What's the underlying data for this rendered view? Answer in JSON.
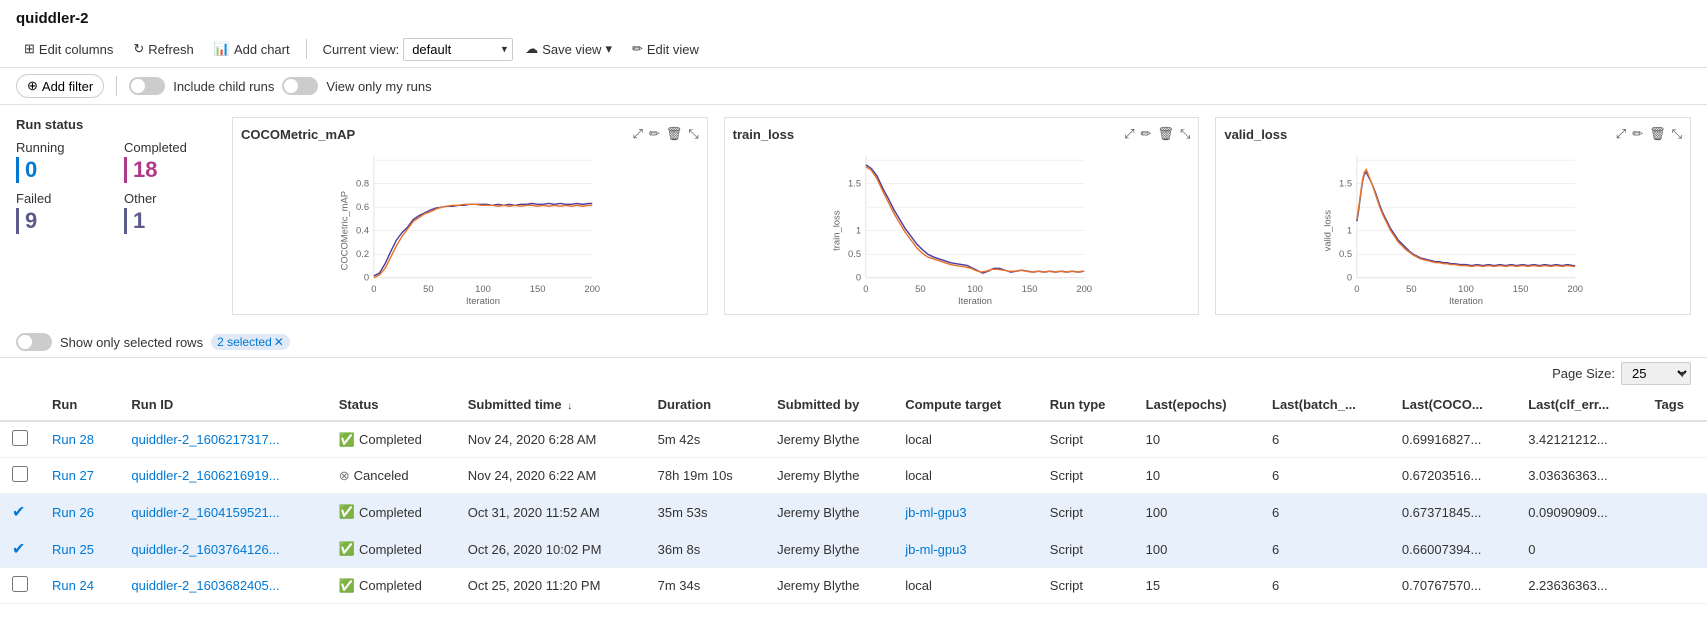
{
  "app": {
    "title": "quiddler-2"
  },
  "toolbar": {
    "edit_columns_label": "Edit columns",
    "refresh_label": "Refresh",
    "add_chart_label": "Add chart",
    "current_view_label": "Current view:",
    "view_options": [
      "default"
    ],
    "current_view": "default",
    "save_view_label": "Save view",
    "edit_view_label": "Edit view"
  },
  "filter_bar": {
    "add_filter_label": "Add filter",
    "include_child_runs_label": "Include child runs",
    "view_only_my_runs_label": "View only my runs"
  },
  "status_panel": {
    "title": "Run status",
    "items": [
      {
        "label": "Running",
        "value": "0",
        "type": "running"
      },
      {
        "label": "Completed",
        "value": "18",
        "type": "completed"
      },
      {
        "label": "Failed",
        "value": "9",
        "type": "failed"
      },
      {
        "label": "Other",
        "value": "1",
        "type": "other"
      }
    ]
  },
  "charts": [
    {
      "title": "COCOMetric_mAP",
      "x_label": "Iteration",
      "y_label": "COCOMetric_mAP",
      "y_min": 0,
      "y_max": 0.8,
      "x_max": 200
    },
    {
      "title": "train_loss",
      "x_label": "Iteration",
      "y_label": "train_loss",
      "y_min": 0,
      "y_max": 1.5,
      "x_max": 200
    },
    {
      "title": "valid_loss",
      "x_label": "Iteration",
      "y_label": "valid_loss",
      "y_min": 0,
      "y_max": 1.5,
      "x_max": 200
    }
  ],
  "selected_rows": {
    "text": "Show only selected rows",
    "count": "2 selected"
  },
  "page_size": {
    "label": "Page Size:",
    "value": "25"
  },
  "table": {
    "columns": [
      "Run",
      "Run ID",
      "Status",
      "Submitted time ↓",
      "Duration",
      "Submitted by",
      "Compute target",
      "Run type",
      "Last(epochs)",
      "Last(batch_...",
      "Last(COCO...",
      "Last(clf_err...",
      "Tags"
    ],
    "rows": [
      {
        "selected": false,
        "run": "Run 28",
        "run_id": "quiddler-2_1606217317...",
        "status": "Completed",
        "submitted_time": "Nov 24, 2020 6:28 AM",
        "duration": "5m 42s",
        "submitted_by": "Jeremy Blythe",
        "compute_target": "local",
        "run_type": "Script",
        "last_epochs": "10",
        "last_batch": "6",
        "last_coco": "0.69916827...",
        "last_clf": "3.42121212...",
        "tags": ""
      },
      {
        "selected": false,
        "run": "Run 27",
        "run_id": "quiddler-2_1606216919...",
        "status": "Canceled",
        "submitted_time": "Nov 24, 2020 6:22 AM",
        "duration": "78h 19m 10s",
        "submitted_by": "Jeremy Blythe",
        "compute_target": "local",
        "run_type": "Script",
        "last_epochs": "10",
        "last_batch": "6",
        "last_coco": "0.67203516...",
        "last_clf": "3.03636363...",
        "tags": ""
      },
      {
        "selected": true,
        "run": "Run 26",
        "run_id": "quiddler-2_1604159521...",
        "status": "Completed",
        "submitted_time": "Oct 31, 2020 11:52 AM",
        "duration": "35m 53s",
        "submitted_by": "Jeremy Blythe",
        "compute_target": "jb-ml-gpu3",
        "compute_link": true,
        "run_type": "Script",
        "last_epochs": "100",
        "last_batch": "6",
        "last_coco": "0.67371845...",
        "last_clf": "0.09090909...",
        "tags": ""
      },
      {
        "selected": true,
        "run": "Run 25",
        "run_id": "quiddler-2_1603764126...",
        "status": "Completed",
        "submitted_time": "Oct 26, 2020 10:02 PM",
        "duration": "36m 8s",
        "submitted_by": "Jeremy Blythe",
        "compute_target": "jb-ml-gpu3",
        "compute_link": true,
        "run_type": "Script",
        "last_epochs": "100",
        "last_batch": "6",
        "last_coco": "0.66007394...",
        "last_clf": "0",
        "tags": ""
      },
      {
        "selected": false,
        "run": "Run 24",
        "run_id": "quiddler-2_1603682405...",
        "status": "Completed",
        "submitted_time": "Oct 25, 2020 11:20 PM",
        "duration": "7m 34s",
        "submitted_by": "Jeremy Blythe",
        "compute_target": "local",
        "run_type": "Script",
        "last_epochs": "15",
        "last_batch": "6",
        "last_coco": "0.70767570...",
        "last_clf": "2.23636363...",
        "tags": ""
      }
    ]
  }
}
